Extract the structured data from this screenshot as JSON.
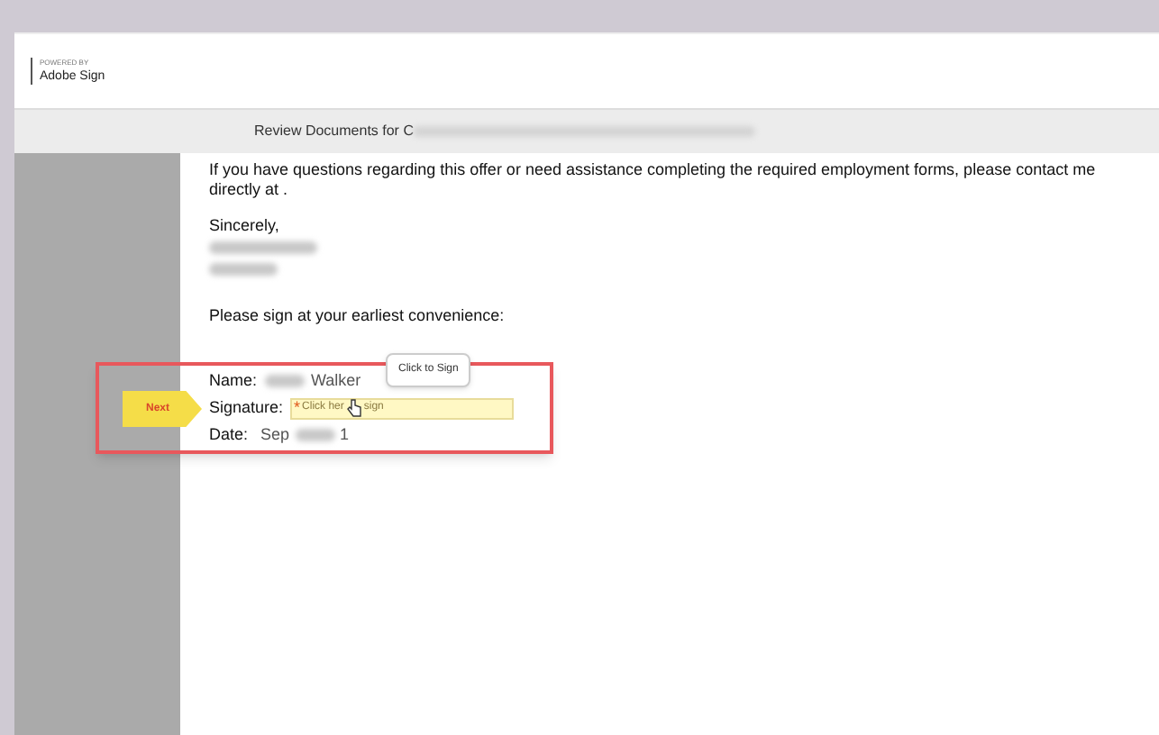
{
  "header": {
    "powered_by": "POWERED BY",
    "brand": "Adobe Sign"
  },
  "title_bar": {
    "title": "Review Documents for C"
  },
  "document": {
    "paragraph": "If you have questions regarding this offer or need assistance completing the required employment forms, please contact me directly at .",
    "closing": "Sincerely,",
    "prompt": "Please sign at your earliest convenience:",
    "fields": [
      {
        "kind": "name",
        "label": "Name:",
        "value": "Walker"
      },
      {
        "kind": "signature",
        "label": "Signature:",
        "required_mark": "*",
        "placeholder": "Click her",
        "placeholder_end": "sign",
        "tooltip": "Click to Sign"
      },
      {
        "kind": "date",
        "label": "Date:",
        "value": "Sep",
        "value_end": "1"
      }
    ]
  },
  "next_tag": {
    "label": "Next"
  }
}
